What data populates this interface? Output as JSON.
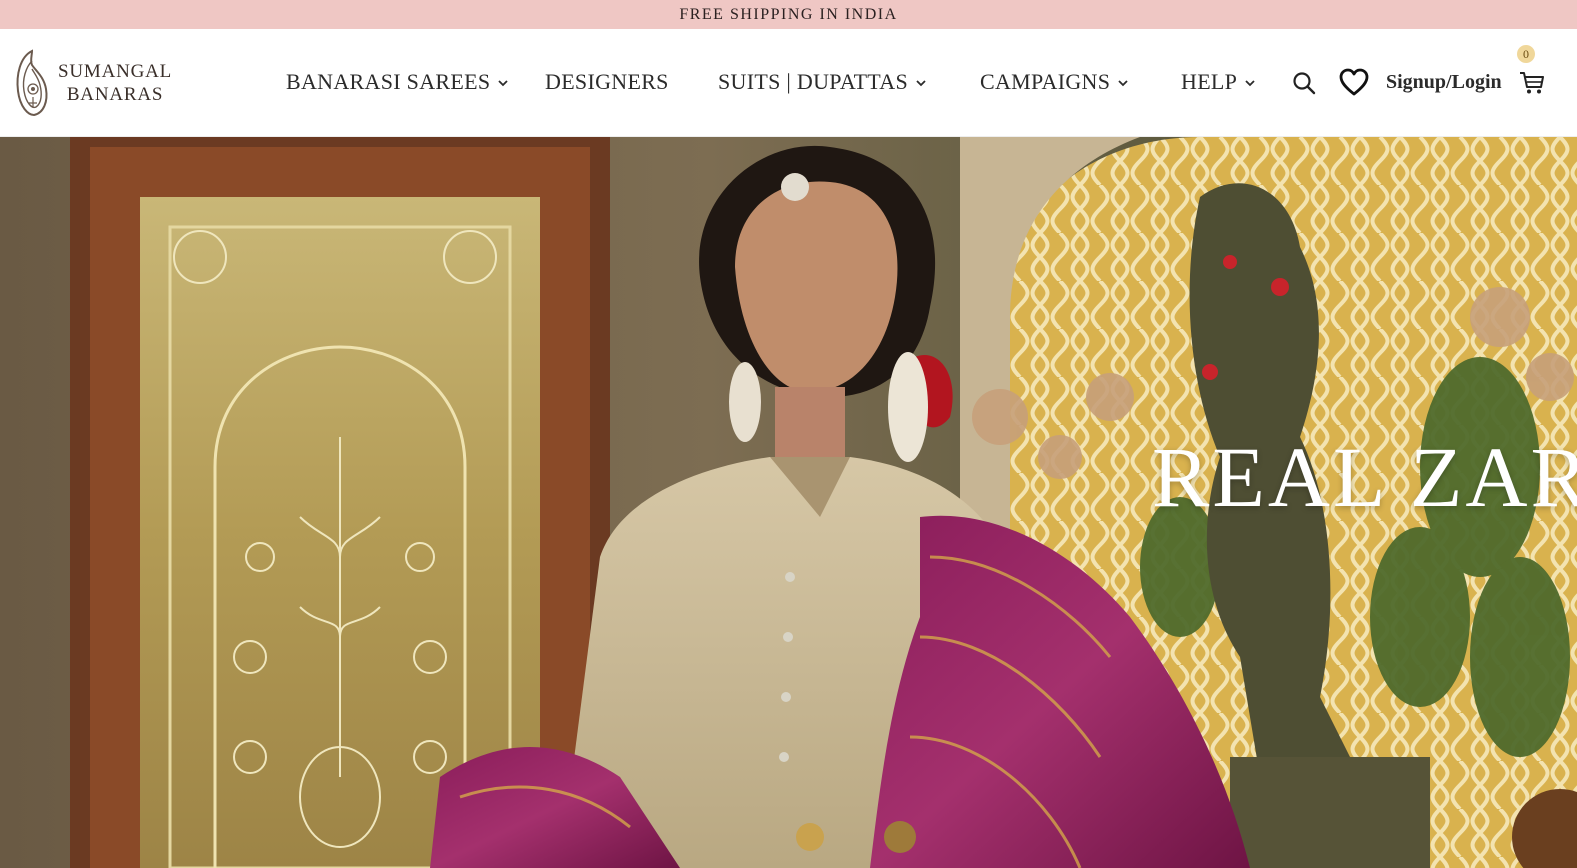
{
  "announcement": {
    "text": "FREE SHIPPING IN INDIA"
  },
  "brand": {
    "line1": "SUMANGAL",
    "line2": "BANARAS"
  },
  "nav": {
    "items": [
      {
        "label": "BANARASI SAREES",
        "has_dropdown": true
      },
      {
        "label": "DESIGNERS",
        "has_dropdown": false
      },
      {
        "label": "SUITS | DUPATTAS",
        "has_dropdown": true
      },
      {
        "label": "CAMPAIGNS",
        "has_dropdown": true
      },
      {
        "label": "HELP",
        "has_dropdown": true
      }
    ]
  },
  "actions": {
    "search_icon": "search-icon",
    "wishlist_icon": "heart-icon",
    "signup_label": "Signup/Login",
    "cart_icon": "cart-icon",
    "cart_count": "0"
  },
  "hero": {
    "title": "REAL ZAR"
  },
  "colors": {
    "announcement_bg": "#efc7c4",
    "badge_bg": "#f0d79a",
    "text": "#2b2b2b"
  }
}
